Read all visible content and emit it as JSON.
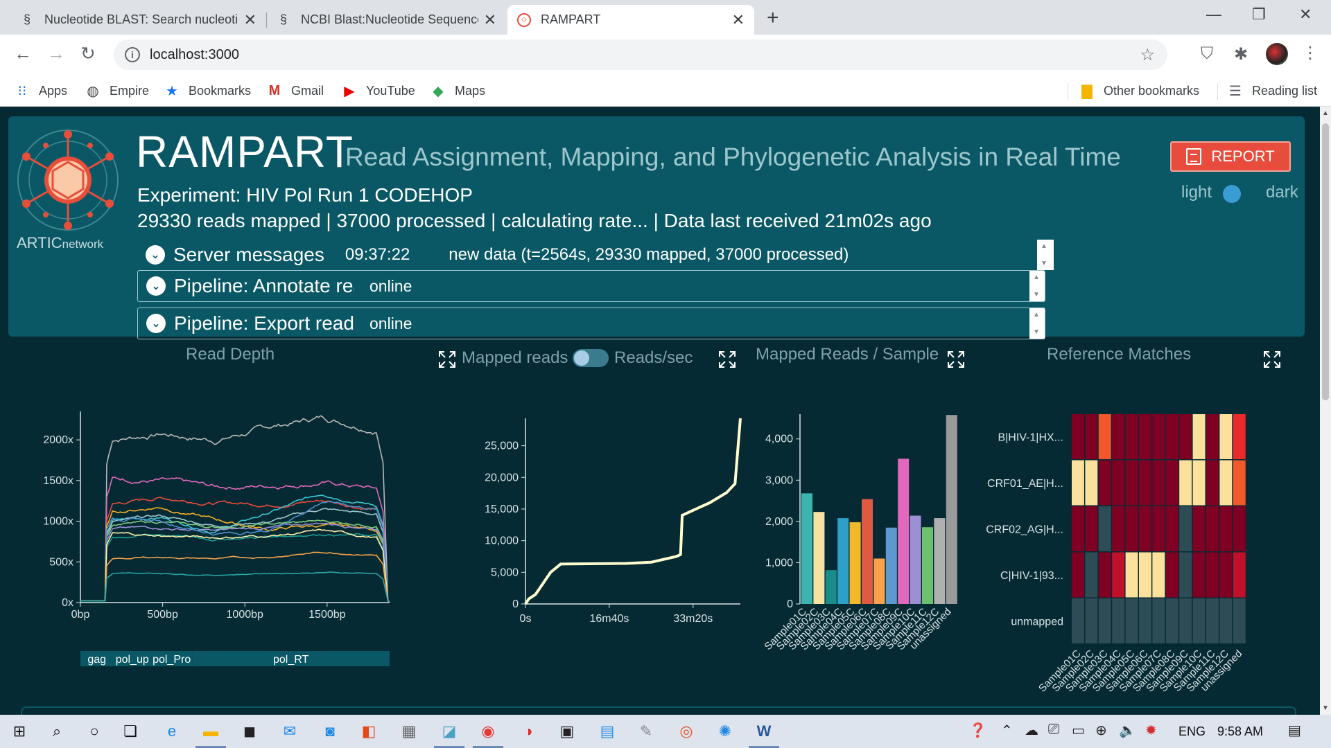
{
  "browser": {
    "tabs": [
      {
        "title": "Nucleotide BLAST: Search nucleotide databases"
      },
      {
        "title": "NCBI Blast:Nucleotide Sequence"
      },
      {
        "title": "RAMPART"
      }
    ],
    "url": "localhost:3000",
    "bookmarks": [
      "Apps",
      "Empire",
      "Bookmarks",
      "Gmail",
      "YouTube",
      "Maps"
    ],
    "other_bookmarks": "Other bookmarks",
    "reading_list": "Reading list"
  },
  "header": {
    "title": "RAMPART",
    "subtitle": "Read Assignment, Mapping, and Phylogenetic Analysis in Real Time",
    "logo_text_main": "ARTIC",
    "logo_text_small": "network",
    "experiment": "Experiment: HIV Pol Run 1 CODEHOP",
    "stats": "29330 reads mapped | 37000 processed | calculating rate... | Data last received 21m02s ago",
    "report_label": "REPORT",
    "theme_light": "light",
    "theme_dark": "dark"
  },
  "server_messages": {
    "label": "Server messages",
    "time": "09:37:22",
    "text": "new data (t=2564s, 29330 mapped, 37000 processed)"
  },
  "pipelines": [
    {
      "name": "Pipeline: Annotate reads",
      "status": "online"
    },
    {
      "name": "Pipeline: Export reads",
      "status": "online"
    }
  ],
  "charts_text": {
    "read_depth": "Read Depth",
    "mapped_reads": "Mapped reads",
    "reads_sec": "Reads/sec",
    "mapped_per_sample": "Mapped Reads / Sample",
    "reference_matches": "Reference Matches"
  },
  "taskbar": {
    "lang": "ENG",
    "time": "9:58 AM"
  },
  "colors": {
    "bg": "#062a33",
    "panel": "#0a5865",
    "report": "#e74c3c",
    "line": "#fffdd0"
  },
  "chart_data": [
    {
      "type": "line",
      "title": "Read Depth",
      "x_ticks": [
        "0bp",
        "500bp",
        "1000bp",
        "1500bp"
      ],
      "y_ticks": [
        "0x",
        "500x",
        "1000x",
        "1500x",
        "2000x"
      ],
      "xlim": [
        0,
        1880
      ],
      "ylim": [
        0,
        2350
      ],
      "genome_features": [
        {
          "name": "gag",
          "start": 0,
          "end": 200
        },
        {
          "name": "pol_up",
          "start": 200,
          "end": 430
        },
        {
          "name": "pol_Pro",
          "start": 430,
          "end": 680
        },
        {
          "name": "pol_RT",
          "start": 680,
          "end": 1880
        }
      ],
      "series": [
        {
          "color": "#b8b8b8",
          "levels": [
            2000,
            2080,
            2000,
            2150,
            2280,
            2150
          ]
        },
        {
          "color": "#e268bd",
          "levels": [
            1520,
            1500,
            1410,
            1440,
            1480,
            1400
          ]
        },
        {
          "color": "#e74c3c",
          "levels": [
            1200,
            1290,
            1230,
            1210,
            1260,
            1150
          ]
        },
        {
          "color": "#3bc5d1",
          "levels": [
            1010,
            1050,
            880,
            1100,
            1340,
            1200
          ]
        },
        {
          "color": "#9ec6cd",
          "levels": [
            980,
            1060,
            950,
            1000,
            1150,
            1080
          ]
        },
        {
          "color": "#f6b026",
          "levels": [
            1100,
            1180,
            1020,
            900,
            950,
            900
          ]
        },
        {
          "color": "#7fc97f",
          "levels": [
            950,
            990,
            920,
            960,
            1000,
            960
          ]
        },
        {
          "color": "#9c8fd3",
          "levels": [
            900,
            920,
            880,
            920,
            980,
            920
          ]
        },
        {
          "color": "#4d8fca",
          "levels": [
            1050,
            1000,
            850,
            880,
            1250,
            1150
          ]
        },
        {
          "color": "#1a9c94",
          "levels": [
            800,
            840,
            780,
            810,
            850,
            820
          ]
        },
        {
          "color": "#fff2a8",
          "levels": [
            850,
            820,
            800,
            820,
            880,
            800
          ]
        },
        {
          "color": "#f7a24a",
          "levels": [
            530,
            560,
            540,
            560,
            620,
            590
          ]
        },
        {
          "color": "#27a5a5",
          "levels": [
            350,
            360,
            340,
            360,
            370,
            360
          ]
        }
      ]
    },
    {
      "type": "line",
      "title": "Mapped reads",
      "x_ticks": [
        "0s",
        "16m40s",
        "33m20s"
      ],
      "y_ticks": [
        "0",
        "5,000",
        "10,000",
        "15,000",
        "20,000",
        "25,000"
      ],
      "xlim": [
        0,
        2564
      ],
      "ylim": [
        0,
        29330
      ],
      "x": [
        0,
        40,
        120,
        300,
        420,
        1200,
        1500,
        1800,
        1850,
        1870,
        2000,
        2200,
        2400,
        2500,
        2564
      ],
      "y": [
        0,
        800,
        1500,
        5000,
        6300,
        6400,
        6600,
        7500,
        7800,
        14000,
        14800,
        16000,
        17600,
        19000,
        29330
      ]
    },
    {
      "type": "bar",
      "title": "Mapped Reads / Sample",
      "categories": [
        "Sample01C",
        "Sample02C",
        "Sample03C",
        "Sample04C",
        "Sample05C",
        "Sample06C",
        "Sample07C",
        "Sample08C",
        "Sample09C",
        "Sample10C",
        "Sample11C",
        "Sample12C",
        "unassigned"
      ],
      "values": [
        2680,
        2230,
        820,
        2080,
        1980,
        2540,
        1100,
        1850,
        3520,
        2140,
        1860,
        2080,
        4580
      ],
      "colors": [
        "#3cb5b0",
        "#f7e3a1",
        "#1a8c8c",
        "#2ca0c8",
        "#f3b82a",
        "#e05a42",
        "#f7a24a",
        "#5e98d1",
        "#e268bd",
        "#9c8fd3",
        "#6dc06d",
        "#b0b0b0",
        "#9a9a9a"
      ],
      "y_ticks": [
        "0",
        "1,000",
        "2,000",
        "3,000",
        "4,000"
      ],
      "ylim": [
        0,
        4600
      ]
    },
    {
      "type": "heatmap",
      "title": "Reference Matches",
      "rows": [
        "B|HIV-1|HX...",
        "CRF01_AE|H...",
        "CRF02_AG|H...",
        "C|HIV-1|93...",
        "unmapped"
      ],
      "columns": [
        "Sample01C",
        "Sample02C",
        "Sample03C",
        "Sample04C",
        "Sample05C",
        "Sample06C",
        "Sample07C",
        "Sample08C",
        "Sample09C",
        "Sample10C",
        "Sample11C",
        "Sample12C",
        "unassigned"
      ],
      "values": [
        [
          0.1,
          0.1,
          0.6,
          0.1,
          0.1,
          0.1,
          0.1,
          0.1,
          0.1,
          0.9,
          0.1,
          0.9,
          0.5
        ],
        [
          0.9,
          0.9,
          0.1,
          0.1,
          0.1,
          0.1,
          0.1,
          0.1,
          0.9,
          0.9,
          0.1,
          0.9,
          0.6
        ],
        [
          0.1,
          0.1,
          -1,
          0.1,
          0.1,
          0.1,
          0.1,
          0.1,
          -1,
          0.1,
          0.1,
          0.1,
          0.1
        ],
        [
          0.1,
          -1,
          0.1,
          0.3,
          0.9,
          0.9,
          0.9,
          0.1,
          -1,
          0.1,
          0.1,
          0.1,
          0.3
        ],
        [
          -1,
          -1,
          -1,
          -1,
          -1,
          -1,
          -1,
          -1,
          -1,
          -1,
          -1,
          -1,
          -1
        ]
      ]
    }
  ]
}
